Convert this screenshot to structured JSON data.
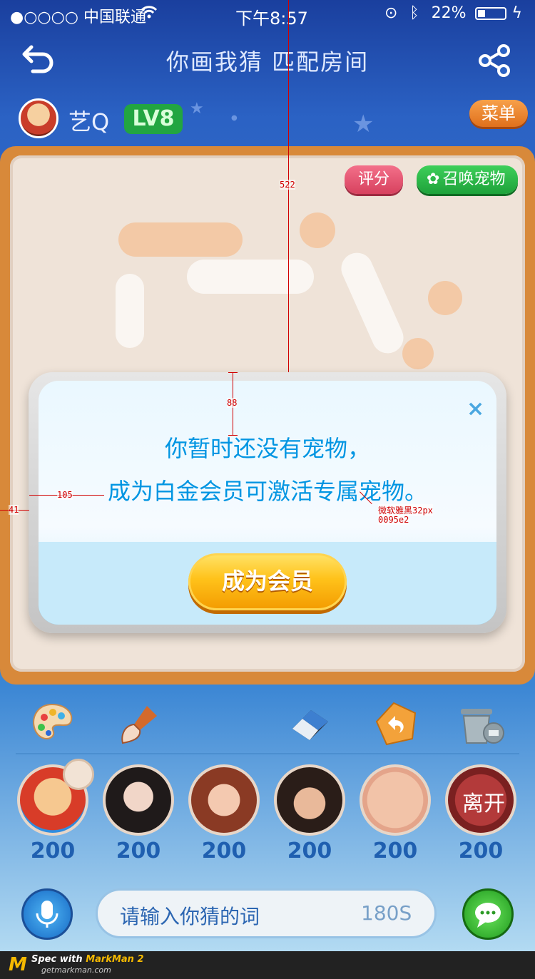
{
  "status_bar": {
    "carrier": "●○○○○ 中国联通",
    "time": "下午8:57",
    "battery": "22%"
  },
  "header": {
    "title": "你画我猜   匹配房间"
  },
  "user": {
    "name": "艺Q",
    "level": "LV8",
    "menu_label": "菜单"
  },
  "board": {
    "rate_label": "评分",
    "summon_pet_label": "召唤宠物"
  },
  "dialog": {
    "line1": "你暂时还没有宠物，",
    "line2": "成为白金会员可激活专属宠物。",
    "cta_label": "成为会员",
    "close_icon": "×"
  },
  "annotations": {
    "m522": "522",
    "m88": "88",
    "m105": "105",
    "m41": "41",
    "font_note": "微软雅黑32px",
    "color_note": "0095e2"
  },
  "players": [
    {
      "score": "200"
    },
    {
      "score": "200"
    },
    {
      "score": "200"
    },
    {
      "score": "200"
    },
    {
      "score": "200"
    },
    {
      "score": "200",
      "overlay": "离开"
    }
  ],
  "input": {
    "placeholder": "请输入你猜的词",
    "timer": "180S"
  },
  "footer": {
    "brand_prefix": "Spec with ",
    "brand_name": "MarkMan 2",
    "site": "getmarkman.com"
  },
  "colors": {
    "dialog_text": "#0095e2",
    "accent_orange": "#ffc21a",
    "level_green": "#22a541"
  }
}
